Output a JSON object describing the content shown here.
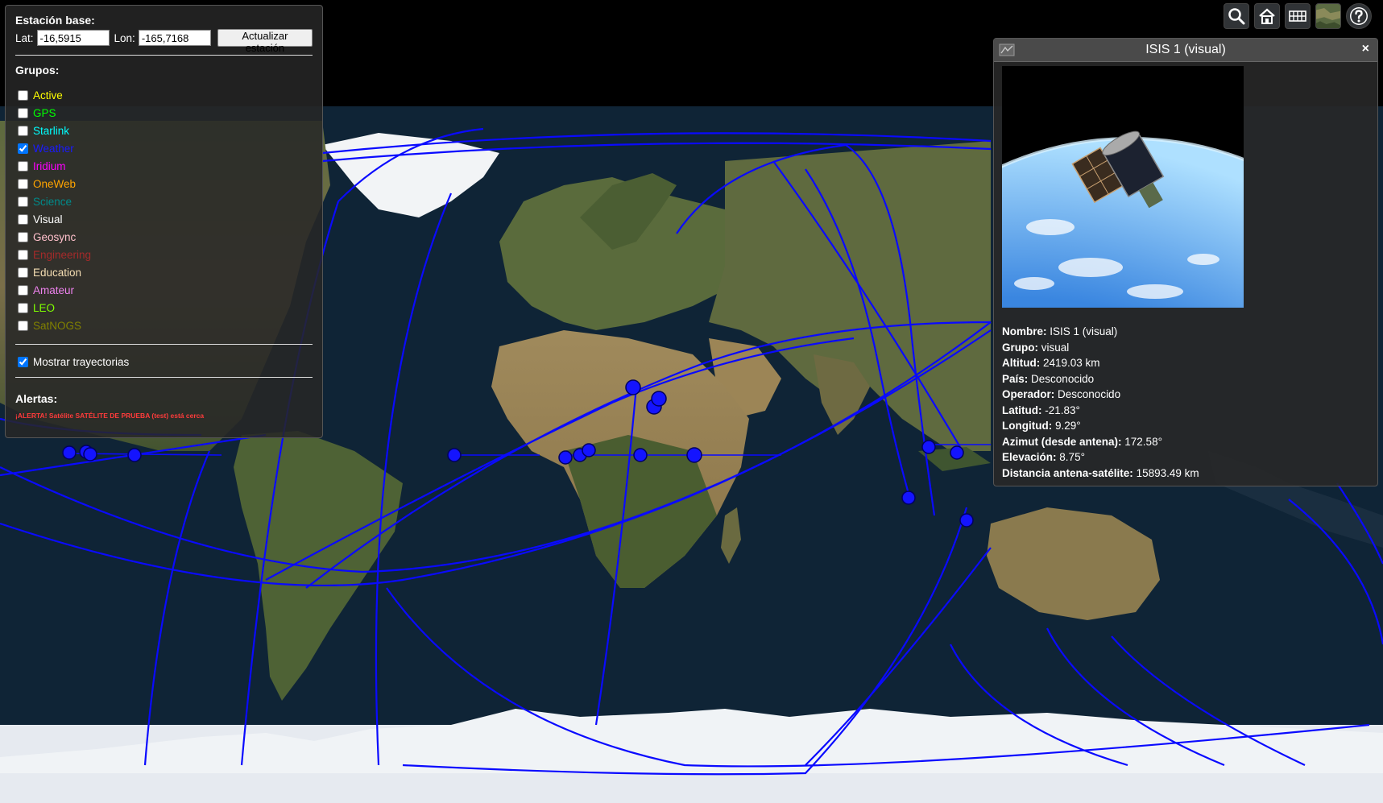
{
  "station": {
    "title": "Estación base:",
    "lat_label": "Lat:",
    "lat_value": "-16,5915",
    "lon_label": "Lon:",
    "lon_value": "-165,7168",
    "update_button": "Actualizar estación"
  },
  "groups": {
    "title": "Grupos:",
    "items": [
      {
        "label": "Active",
        "color": "#ffff00",
        "checked": false
      },
      {
        "label": "GPS",
        "color": "#00ff00",
        "checked": false
      },
      {
        "label": "Starlink",
        "color": "#00ffff",
        "checked": false
      },
      {
        "label": "Weather",
        "color": "#1a1aff",
        "checked": true
      },
      {
        "label": "Iridium",
        "color": "#ff00ff",
        "checked": false
      },
      {
        "label": "OneWeb",
        "color": "#ffa500",
        "checked": false
      },
      {
        "label": "Science",
        "color": "#008b8b",
        "checked": false
      },
      {
        "label": "Visual",
        "color": "#ffffff",
        "checked": false
      },
      {
        "label": "Geosync",
        "color": "#ffc0cb",
        "checked": false
      },
      {
        "label": "Engineering",
        "color": "#a52a2a",
        "checked": false
      },
      {
        "label": "Education",
        "color": "#f5deb3",
        "checked": false
      },
      {
        "label": "Amateur",
        "color": "#ee82ee",
        "checked": false
      },
      {
        "label": "LEO",
        "color": "#7fff00",
        "checked": false
      },
      {
        "label": "SatNOGS",
        "color": "#808000",
        "checked": false
      }
    ]
  },
  "show_trajectories": {
    "label": "Mostrar trayectorias",
    "checked": true
  },
  "alerts": {
    "title": "Alertas:",
    "message": "¡ALERTA! Satélite SATÉLITE DE PRUEBA (test) está cerca"
  },
  "toolbar": {
    "icons": [
      "search-icon",
      "home-icon",
      "grid-icon",
      "imagery-icon",
      "help-icon"
    ]
  },
  "info_panel": {
    "title": "ISIS 1 (visual)",
    "close": "×",
    "fields": [
      {
        "key": "Nombre:",
        "value": "ISIS 1 (visual)"
      },
      {
        "key": "Grupo:",
        "value": "visual"
      },
      {
        "key": "Altitud:",
        "value": "2419.03 km"
      },
      {
        "key": "País:",
        "value": "Desconocido"
      },
      {
        "key": "Operador:",
        "value": "Desconocido"
      },
      {
        "key": "Latitud:",
        "value": "-21.83°"
      },
      {
        "key": "Longitud:",
        "value": "9.29°"
      },
      {
        "key": "Azimut (desde antena):",
        "value": "172.58°"
      },
      {
        "key": "Elevación:",
        "value": "8.75°"
      },
      {
        "key": "Distancia antena-satélite:",
        "value": "15893.49 km"
      }
    ]
  },
  "colors": {
    "orbit": "#0a0aff",
    "ocean": "#0f2436",
    "land": "#4d5a34",
    "ice": "#e9edf2"
  }
}
